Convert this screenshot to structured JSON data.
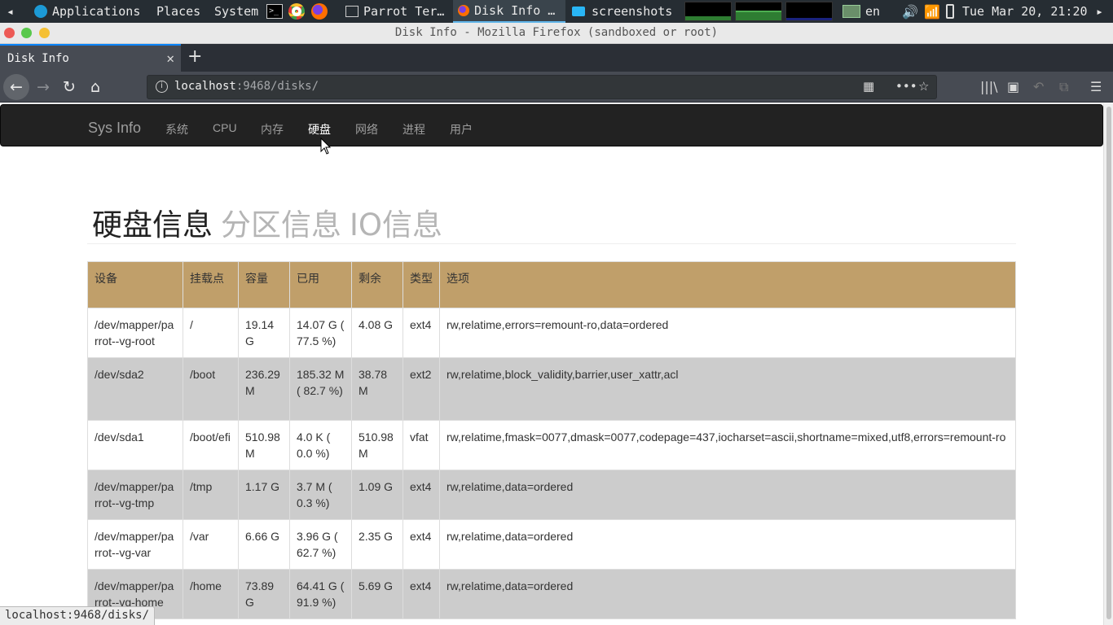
{
  "desktop_panel": {
    "menu_applications": "Applications",
    "menu_places": "Places",
    "menu_system": "System",
    "tasks": [
      {
        "label": "Parrot Ter…",
        "icon": "terminal-icon"
      },
      {
        "label": "Disk Info …",
        "icon": "firefox-icon"
      },
      {
        "label": "screenshots",
        "icon": "folder-icon"
      }
    ],
    "keyboard_layout": "en",
    "clock": "Tue Mar 20, 21:20"
  },
  "window": {
    "title": "Disk Info - Mozilla Firefox (sandboxed or root)"
  },
  "browser": {
    "tab_title": "Disk Info",
    "url_host": "localhost",
    "url_rest": ":9468/disks/",
    "status_url": "localhost:9468/disks/"
  },
  "site": {
    "brand": "Sys Info",
    "nav": [
      "系统",
      "CPU",
      "内存",
      "硬盘",
      "网络",
      "进程",
      "用户"
    ],
    "active_nav": "硬盘",
    "heading_main": "硬盘信息",
    "heading_tabs": [
      "分区信息",
      "IO信息"
    ],
    "colors": {
      "table_header": "#c09f6a",
      "row_alt": "#cccccc",
      "navbar": "#222222"
    }
  },
  "table": {
    "headers": [
      "设备",
      "挂载点",
      "容量",
      "已用",
      "剩余",
      "类型",
      "选项"
    ],
    "rows": [
      {
        "device": "/dev/mapper/parrot--vg-root",
        "mount": "/",
        "capacity": "19.14 G",
        "used": "14.07 G ( 77.5 %)",
        "free": "4.08 G",
        "type": "ext4",
        "options": "rw,relatime,errors=remount-ro,data=ordered"
      },
      {
        "device": "/dev/sda2",
        "mount": "/boot",
        "capacity": "236.29 M",
        "used": "185.32 M ( 82.7 %)",
        "free": "38.78 M",
        "type": "ext2",
        "options": "rw,relatime,block_validity,barrier,user_xattr,acl"
      },
      {
        "device": "/dev/sda1",
        "mount": "/boot/efi",
        "capacity": "510.98 M",
        "used": "4.0 K ( 0.0 %)",
        "free": "510.98 M",
        "type": "vfat",
        "options": "rw,relatime,fmask=0077,dmask=0077,codepage=437,iocharset=ascii,shortname=mixed,utf8,errors=remount-ro"
      },
      {
        "device": "/dev/mapper/parrot--vg-tmp",
        "mount": "/tmp",
        "capacity": "1.17 G",
        "used": "3.7 M ( 0.3 %)",
        "free": "1.09 G",
        "type": "ext4",
        "options": "rw,relatime,data=ordered"
      },
      {
        "device": "/dev/mapper/parrot--vg-var",
        "mount": "/var",
        "capacity": "6.66 G",
        "used": "3.96 G ( 62.7 %)",
        "free": "2.35 G",
        "type": "ext4",
        "options": "rw,relatime,data=ordered"
      },
      {
        "device": "/dev/mapper/parrot--vg-home",
        "mount": "/home",
        "capacity": "73.89 G",
        "used": "64.41 G ( 91.9 %)",
        "free": "5.69 G",
        "type": "ext4",
        "options": "rw,relatime,data=ordered"
      }
    ]
  }
}
